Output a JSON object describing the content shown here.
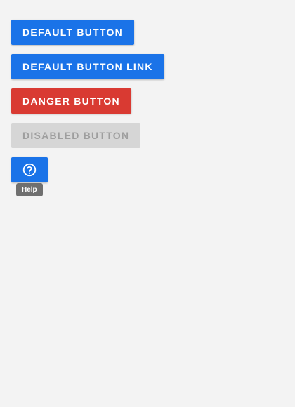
{
  "buttons": {
    "default_label": "Default Button",
    "default_link_label": "Default Button Link",
    "danger_label": "Danger Button",
    "disabled_label": "Disabled Button"
  },
  "help_button": {
    "icon": "help-circle-icon",
    "tooltip": "Help"
  },
  "colors": {
    "primary": "#1a73e8",
    "danger": "#d93a32",
    "disabled_bg": "#d6d6d6",
    "disabled_text": "#9e9e9e",
    "tooltip_bg": "#6f6f6f",
    "background": "#f3f3f3"
  }
}
